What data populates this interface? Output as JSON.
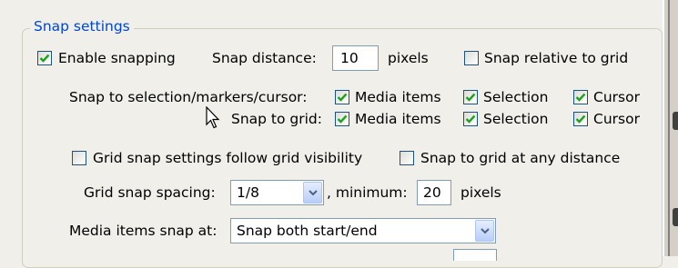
{
  "group": {
    "title": "Snap settings"
  },
  "enable_snapping": {
    "label": "Enable snapping",
    "checked": true
  },
  "snap_distance": {
    "label": "Snap distance:",
    "value": "10",
    "unit": "pixels"
  },
  "snap_relative_to_grid": {
    "label": "Snap relative to grid",
    "checked": false
  },
  "snap_to_selection_row": {
    "label": "Snap to selection/markers/cursor:",
    "media_items": {
      "label": "Media items",
      "checked": true
    },
    "selection": {
      "label": "Selection",
      "checked": true
    },
    "cursor": {
      "label": "Cursor",
      "checked": true
    }
  },
  "snap_to_grid_row": {
    "label": "Snap to grid:",
    "media_items": {
      "label": "Media items",
      "checked": true
    },
    "selection": {
      "label": "Selection",
      "checked": true
    },
    "cursor": {
      "label": "Cursor",
      "checked": true
    }
  },
  "grid_follow_visibility": {
    "label": "Grid snap settings follow grid visibility",
    "checked": false
  },
  "snap_any_distance": {
    "label": "Snap to grid at any distance",
    "checked": false
  },
  "grid_spacing": {
    "label": "Grid snap spacing:",
    "value": "1/8",
    "minimum_label": ", minimum:",
    "minimum_value": "20",
    "unit": "pixels"
  },
  "media_snap_at": {
    "label": "Media items snap at:",
    "value": "Snap both start/end"
  },
  "colors": {
    "accent_title": "#0046d5",
    "check_mark": "#21a121",
    "checkbox_border": "#1c5180",
    "field_border": "#7f9db9",
    "background": "#f0efe9"
  },
  "icons": {
    "checkmark": "check-icon",
    "dropdown": "chevron-down-icon",
    "pointer": "mouse-cursor-icon"
  }
}
